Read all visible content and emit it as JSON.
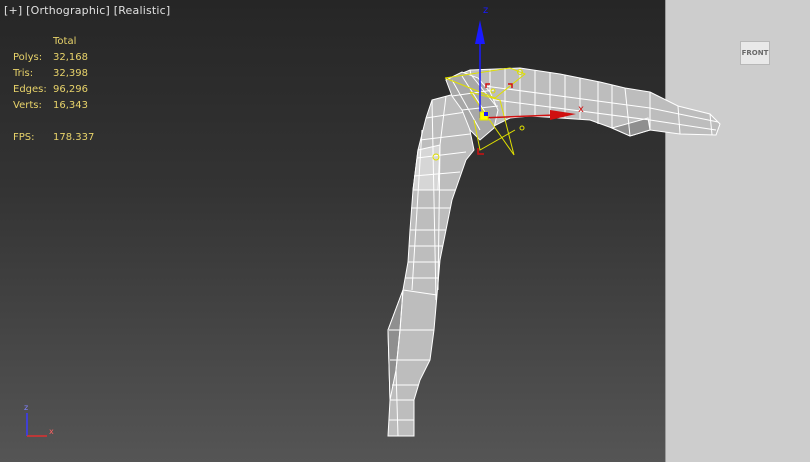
{
  "viewport_menu": {
    "plus": "[+]",
    "view": "[Orthographic]",
    "shading": "[Realistic]"
  },
  "stats": {
    "header": "Total",
    "rows": [
      {
        "label": "Polys:",
        "value": "32,168"
      },
      {
        "label": "Tris:",
        "value": "32,398"
      },
      {
        "label": "Edges:",
        "value": "96,296"
      },
      {
        "label": "Verts:",
        "value": "16,343"
      }
    ],
    "fps_label": "FPS:",
    "fps_value": "178.337"
  },
  "viewcube": {
    "label": "FRONT"
  },
  "gizmo": {
    "z": "z",
    "x": "x"
  },
  "axis_tripod": {
    "z": "z",
    "x": "x"
  },
  "colors": {
    "stats_text": "#e8d36a",
    "gizmo_z": "#1a1aff",
    "gizmo_x": "#d01010",
    "gizmo_y": "#e0e000",
    "wire": "#ffffff"
  }
}
